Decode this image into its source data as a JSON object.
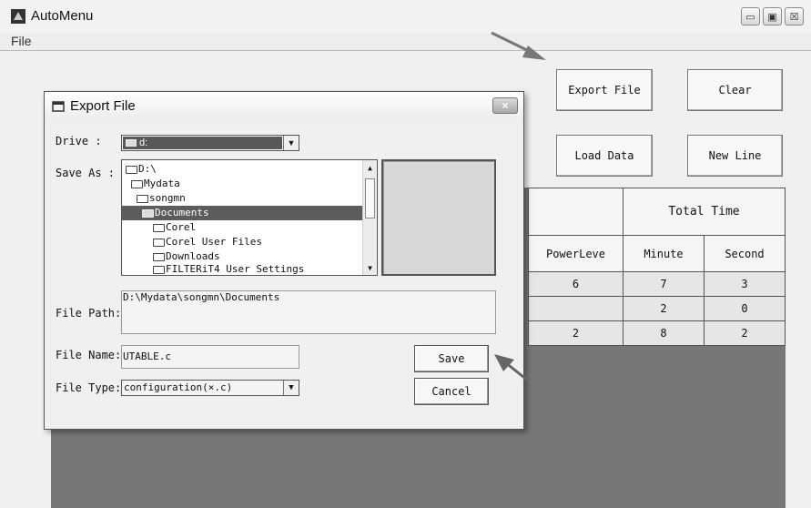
{
  "window": {
    "title": "AutoMenu",
    "buttons": {
      "minimize": "▭",
      "maximize": "▣",
      "close": "☒"
    }
  },
  "menu": {
    "file": "File"
  },
  "main": {
    "export_file": "Export File",
    "clear": "Clear",
    "load_data": "Load Data",
    "new_line": "New Line",
    "table": {
      "group_header": "Total Time",
      "columns": [
        "PowerLeve",
        "Minute",
        "Second"
      ],
      "rows": [
        [
          "6",
          "7",
          "3"
        ],
        [
          "",
          "2",
          "0"
        ],
        [
          "2",
          "8",
          "2"
        ]
      ]
    }
  },
  "dialog": {
    "title": "Export File",
    "close": "×",
    "drive_label": "Drive :",
    "drive_value": "d:",
    "save_as_label": "Save As :",
    "folders": [
      "D:\\",
      "Mydata",
      "songmn",
      "Documents",
      "Corel",
      "Corel User Files",
      "Downloads",
      "FILTERiT4 User Settings"
    ],
    "file_path_label": "File Path:",
    "file_path_value": "D:\\Mydata\\songmn\\Documents",
    "file_name_label": "File Name:",
    "file_name_value": "UTABLE.c",
    "file_type_label": "File Type:",
    "file_type_value": "configuration(×.c)",
    "save": "Save",
    "cancel": "Cancel"
  },
  "colors": {
    "selection": "#5c5c5c",
    "client_dark": "#777777",
    "table_fill": "#e6e6e6"
  }
}
